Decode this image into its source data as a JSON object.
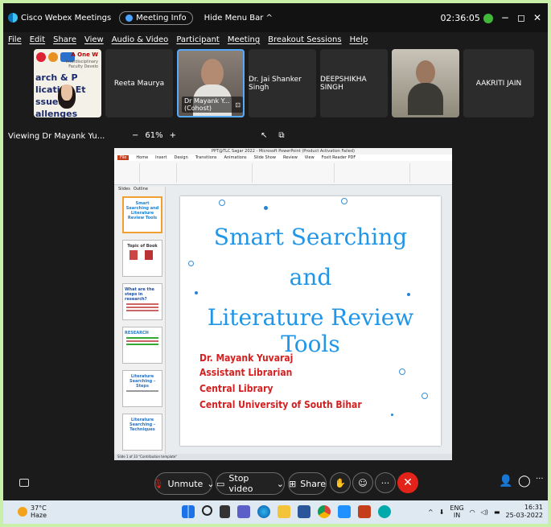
{
  "topbar": {
    "app_name": "Cisco Webex Meetings",
    "meeting_info": "Meeting Info",
    "hide_menu": "Hide Menu Bar ^",
    "timer": "02:36:05",
    "minimize": "−",
    "restore": "◻",
    "close": "✕"
  },
  "menu": [
    "File",
    "Edit",
    "Share",
    "View",
    "Audio & Video",
    "Participant",
    "Meeting",
    "Breakout Sessions",
    "Help"
  ],
  "participants": [
    {
      "name": "Reeta Maurya"
    },
    {
      "name": "Dr Mayank Y... (Cohost)"
    },
    {
      "name": "Dr. Jai Shanker Singh"
    },
    {
      "name": "DEEPSHIKHA SINGH"
    },
    {
      "name": "AAKRITI JAIN"
    }
  ],
  "shared_tile": {
    "one_we": "A One W",
    "sub1": "Interdisciplinary",
    "sub2": "Faculty Develo",
    "line1": "arch & P  lication Et",
    "line2": "ssues a  allenges"
  },
  "viewing": {
    "label": "Viewing Dr Mayank Yu...",
    "zoom_minus": "−",
    "zoom_value": "61%",
    "zoom_plus": "+",
    "cursor_icon": "↖",
    "fit_icon": "⧉"
  },
  "ppt": {
    "window_title": "PPT@TLC Sagar 2022 - Microsoft PowerPoint (Product Activation Failed)",
    "tabs": [
      "File",
      "Home",
      "Insert",
      "Design",
      "Transitions",
      "Animations",
      "Slide Show",
      "Review",
      "View",
      "Foxit Reader PDF"
    ],
    "panel_tabs": [
      "Slides",
      "Outline"
    ],
    "thumbs": [
      {
        "num": "1",
        "title": "Smart Searching and Literature Review Tools"
      },
      {
        "num": "2",
        "title": "Topic of Book"
      },
      {
        "num": "3",
        "title": "What are the steps in research?"
      },
      {
        "num": "4",
        "title": "RESEARCH"
      },
      {
        "num": "5",
        "title": "Literature Searching - Steps"
      },
      {
        "num": "6",
        "title": "Literature Searching - Techniques"
      }
    ],
    "status": "Slide 1 of 33   \"Contribution template\""
  },
  "slide": {
    "title_line1": "Smart Searching",
    "title_line2": "and",
    "title_line3": "Literature Review Tools",
    "author": "Dr. Mayank Yuvaraj",
    "role": "Assistant Librarian",
    "dept": "Central Library",
    "org": "Central University of South Bihar"
  },
  "controls": {
    "unmute": "Unmute",
    "stop_video": "Stop video",
    "share": "Share",
    "more": "···",
    "end": "✕"
  },
  "taskbar": {
    "temperature": "37°C",
    "weather": "Haze",
    "lang_top": "ENG",
    "lang_bottom": "IN",
    "time": "16:31",
    "date": "25-03-2022"
  },
  "colors": {
    "slide_title": "#2196e8",
    "slide_author": "#d42020",
    "end_button": "#e2231a",
    "active_tile_border": "#55aaff"
  }
}
